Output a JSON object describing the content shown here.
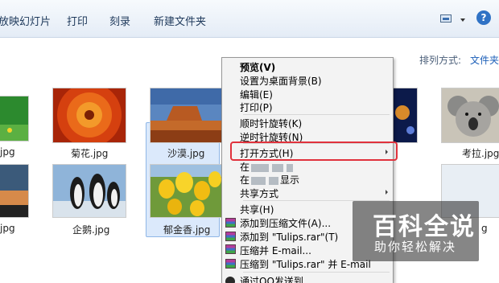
{
  "toolbar": {
    "items": [
      "放映幻灯片",
      "打印",
      "刻录",
      "新建文件夹"
    ],
    "view_icon": "view-icon",
    "help_icon": "help-icon",
    "help_label": "?"
  },
  "content": {
    "arrange_label": "排列方式:",
    "arrange_value": "文件夹"
  },
  "files": {
    "row1": [
      "jpg",
      "菊花.jpg",
      "沙漠.jpg",
      "考拉.jpg"
    ],
    "row2": [
      "jpg",
      "企鹅.jpg",
      "郁金香.jpg",
      "g"
    ]
  },
  "menu": {
    "preview": "预览(V)",
    "set_desktop": "设置为桌面背景(B)",
    "edit": "编辑(E)",
    "print": "打印(P)",
    "rotate_cw": "顺时针旋转(K)",
    "rotate_ccw": "逆时针旋转(N)",
    "open_with": "打开方式(H)",
    "blurred1_prefix": "在",
    "blurred2_prefix": "在",
    "blurred2_suffix": "显示",
    "share_with": "共享方式",
    "share": "共享(H)",
    "add_archive": "添加到压缩文件(A)...",
    "add_rar": "添加到 \"Tulips.rar\"(T)",
    "compress_email": "压缩并 E-mail...",
    "compress_rar_email": "压缩到 \"Tulips.rar\" 并 E-mail",
    "send_qq": "通过QQ发送到"
  },
  "watermark": {
    "title": "百科全说",
    "subtitle": "助你轻松解决"
  },
  "colors": {
    "highlight_box": "#e0323c",
    "toolbar_bg": "#e4ecf6",
    "selection": "#dbe9fb"
  }
}
